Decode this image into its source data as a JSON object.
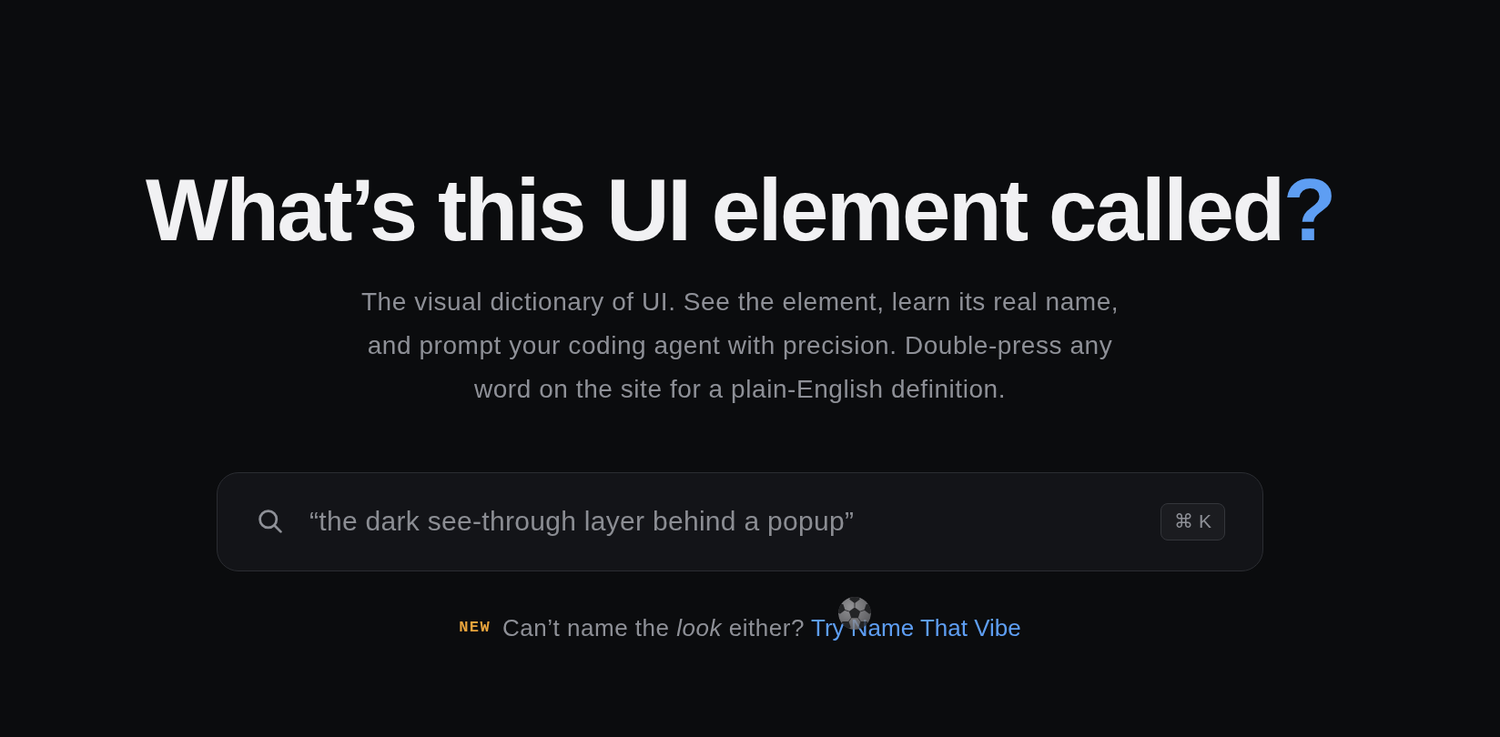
{
  "hero": {
    "title": "What’s this UI element called",
    "title_accent": "?",
    "subtitle": "The visual dictionary of UI. See the element, learn its real name, and prompt your coding agent with precision. Double-press any word on the site for a plain-English definition."
  },
  "search": {
    "placeholder": "“the dark see-through layer behind a popup”",
    "shortcut": "⌘ K"
  },
  "promo": {
    "badge": "NEW",
    "text": "Can’t name the *look* either?",
    "link": "Try Name That Vibe"
  }
}
